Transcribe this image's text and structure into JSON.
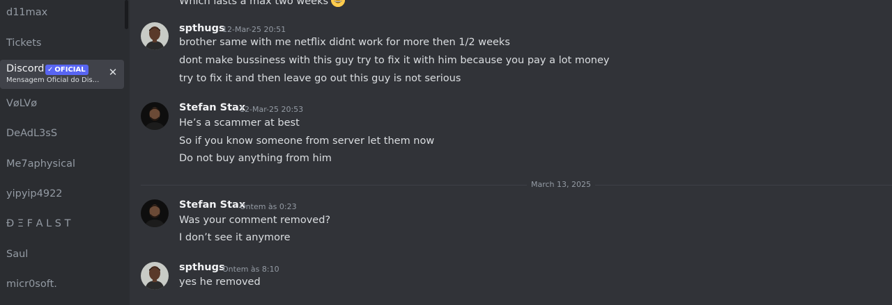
{
  "sidebar": {
    "dms": [
      {
        "name": "d11max"
      },
      {
        "name": "Tickets"
      },
      {
        "name": "VøLVø"
      },
      {
        "name": "DeAdL3sS"
      },
      {
        "name": "Me7aphysical"
      },
      {
        "name": "yipyip4922"
      },
      {
        "name": "Ð Ξ F A L S T"
      },
      {
        "name": "Saul"
      },
      {
        "name": "micr0soft."
      }
    ],
    "active": {
      "name": "Discord",
      "badge": "OFICIAL",
      "badge_check": "✓",
      "subtitle": "Mensagem Oficial do Dis...",
      "close_glyph": "✕"
    }
  },
  "chat": {
    "top_partial_text": "Which lasts a max two weeks",
    "date_divider": "March 13, 2025",
    "messages": [
      {
        "author": "spthugs",
        "time": "12-Mar-25 20:51",
        "lines": [
          "brother  same  with me netflix didnt work for more then 1/2 weeks",
          "dont make bussiness with this guy try to fix it with him because you pay a lot money",
          "try to fix it and then leave go out this guy is not serious"
        ]
      },
      {
        "author": "Stefan Stax",
        "time": "12-Mar-25 20:53",
        "lines": [
          "He’s a scammer at best",
          "So if you know someone from server let them now",
          "Do not buy anything from him"
        ]
      },
      {
        "author": "Stefan Stax",
        "time": "Ontem às 0:23",
        "lines": [
          "Was your comment removed?",
          "I don’t see it anymore"
        ]
      },
      {
        "author": "spthugs",
        "time": "Ontem às 8:10",
        "lines": [
          "yes he removed"
        ]
      }
    ]
  },
  "colors": {
    "sidebar_bg": "#2b2d31",
    "chat_bg": "#313338",
    "active_bg": "#404249",
    "badge_bg": "#5865f2",
    "text_muted": "#949ba4",
    "text_normal": "#dbdee1",
    "text_header": "#f2f3f5"
  },
  "icons": {
    "emoji": "grinning-face-emoji",
    "badge_check": "checkmark-icon",
    "close": "close-icon"
  }
}
